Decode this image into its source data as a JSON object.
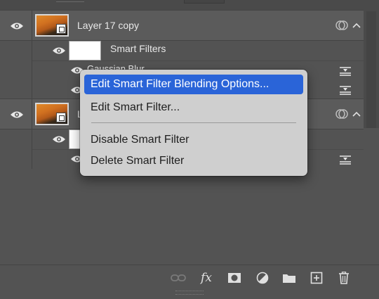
{
  "layers": [
    {
      "name": "Layer 17 copy",
      "sub_label": "Smart Filters",
      "filters": [
        "Gaussian Blur",
        ""
      ]
    },
    {
      "name": "L",
      "sub_label": "",
      "filters": [
        ""
      ]
    }
  ],
  "context_menu": {
    "items": [
      {
        "label": "Edit Smart Filter Blending Options...",
        "highlighted": true
      },
      {
        "label": "Edit Smart Filter..."
      },
      {
        "label": "Disable Smart Filter"
      },
      {
        "label": "Delete Smart Filter"
      }
    ]
  },
  "bottom_bar": {
    "icons": [
      "link-layers-icon",
      "fx-icon",
      "layer-mask-icon",
      "adjustment-layer-icon",
      "group-folder-icon",
      "new-layer-icon",
      "trash-icon"
    ],
    "fx_label": "fx"
  },
  "colors": {
    "panel_bg": "#535353",
    "menu_bg": "#cfcfcf",
    "menu_highlight": "#2a64d8"
  }
}
